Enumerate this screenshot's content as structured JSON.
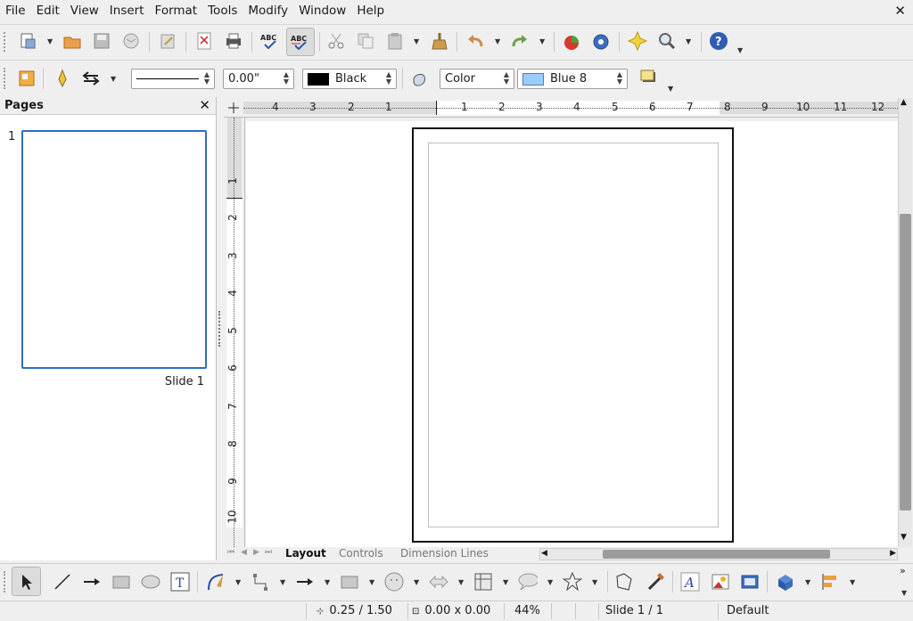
{
  "menu": {
    "items": [
      "File",
      "Edit",
      "View",
      "Insert",
      "Format",
      "Tools",
      "Modify",
      "Window",
      "Help"
    ]
  },
  "line_properties": {
    "width_value": "0.00\"",
    "line_color": "Black",
    "line_color_hex": "#000000",
    "area_style": "Color",
    "area_color": "Blue 8",
    "area_color_hex": "#99ccff"
  },
  "pages_panel": {
    "title": "Pages",
    "slides": [
      {
        "number": "1",
        "label": "Slide 1"
      }
    ]
  },
  "rulers": {
    "horizontal": [
      "4",
      "3",
      "2",
      "1",
      "1",
      "2",
      "3",
      "4",
      "5",
      "6",
      "7",
      "8",
      "9",
      "10",
      "11",
      "12"
    ],
    "vertical": [
      "1",
      "2",
      "3",
      "4",
      "5",
      "6",
      "7",
      "8",
      "9",
      "10"
    ]
  },
  "tabs": [
    "Layout",
    "Controls",
    "Dimension Lines"
  ],
  "status": {
    "position": "0.25 / 1.50",
    "size": "0.00 x 0.00",
    "zoom": "44%",
    "slide": "Slide 1 / 1",
    "layout": "Default"
  },
  "icons": {
    "toolbar1": [
      "new-document-icon",
      "open-icon",
      "save-icon",
      "email-icon",
      "edit-file-icon",
      "export-pdf-icon",
      "print-icon",
      "spellcheck-icon",
      "autospellcheck-icon",
      "cut-icon",
      "copy-icon",
      "paste-icon",
      "clone-formatting-icon",
      "undo-icon",
      "redo-icon",
      "chart-icon",
      "navigator-icon",
      "effects-icon",
      "zoom-icon",
      "help-icon"
    ],
    "drawing": [
      "select-icon",
      "line-icon",
      "arrow-line-icon",
      "rectangle-icon",
      "ellipse-icon",
      "text-icon",
      "curve-icon",
      "connector-icon",
      "lines-arrows-icon",
      "basic-shapes-icon",
      "symbol-shapes-icon",
      "block-arrows-icon",
      "flowchart-icon",
      "callouts-icon",
      "stars-icon",
      "points-icon",
      "glue-points-icon",
      "fontwork-icon",
      "from-file-icon",
      "gallery-icon",
      "extrusion-icon",
      "align-icon"
    ]
  },
  "colors": {
    "accent": "#2f6cc0",
    "background": "#efefef"
  }
}
